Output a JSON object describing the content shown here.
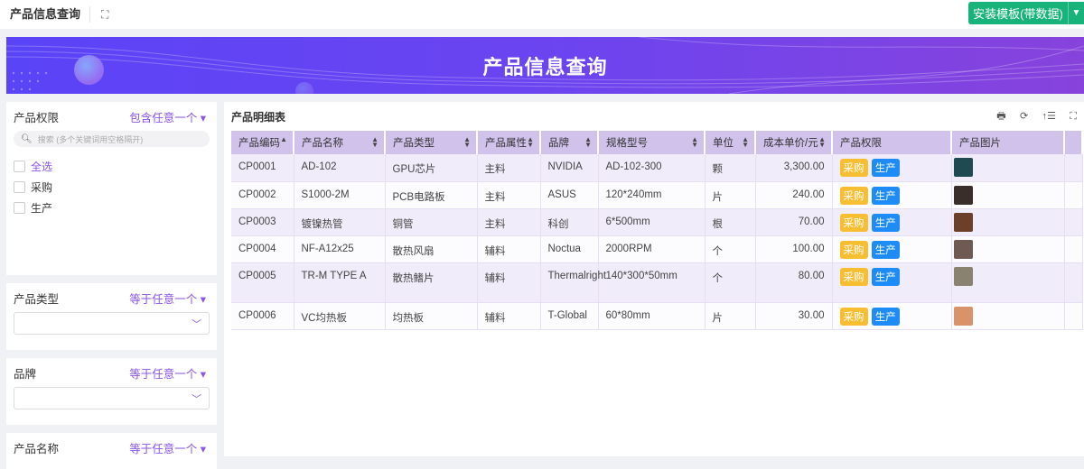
{
  "topbar": {
    "title": "产品信息查询",
    "install_label": "安装模板(带数据)"
  },
  "banner": {
    "title": "产品信息查询"
  },
  "filters": [
    {
      "label": "产品权限",
      "mode": "包含任意一个",
      "search_placeholder": "搜索 (多个关键词用空格隔开)",
      "options": [
        "全选",
        "采购",
        "生产"
      ]
    },
    {
      "label": "产品类型",
      "mode": "等于任意一个"
    },
    {
      "label": "品牌",
      "mode": "等于任意一个"
    },
    {
      "label": "产品名称",
      "mode": "等于任意一个"
    }
  ],
  "table": {
    "title": "产品明细表",
    "columns": [
      "产品编码",
      "产品名称",
      "产品类型",
      "产品属性",
      "品牌",
      "规格型号",
      "单位",
      "成本单价/元",
      "产品权限",
      "产品图片"
    ],
    "rows": [
      {
        "code": "CP0001",
        "name": "AD-102",
        "type": "GPU芯片",
        "attr": "主料",
        "brand": "NVIDIA",
        "spec": "AD-102-300",
        "unit": "颗",
        "price": "3,300.00",
        "perms": [
          "采购",
          "生产"
        ],
        "img": "#1f4a52"
      },
      {
        "code": "CP0002",
        "name": "S1000-2M",
        "type": "PCB电路板",
        "attr": "主料",
        "brand": "ASUS",
        "spec": "120*240mm",
        "unit": "片",
        "price": "240.00",
        "perms": [
          "采购",
          "生产"
        ],
        "img": "#3a2e2a"
      },
      {
        "code": "CP0003",
        "name": "镀镍热管",
        "type": "铜管",
        "attr": "主料",
        "brand": "科创",
        "spec": "6*500mm",
        "unit": "根",
        "price": "70.00",
        "perms": [
          "采购",
          "生产"
        ],
        "img": "#6b3f2a"
      },
      {
        "code": "CP0004",
        "name": "NF-A12x25",
        "type": "散热风扇",
        "attr": "辅料",
        "brand": "Noctua",
        "spec": "2000RPM",
        "unit": "个",
        "price": "100.00",
        "perms": [
          "采购",
          "生产"
        ],
        "img": "#6e5a52"
      },
      {
        "code": "CP0005",
        "name": "TR-M TYPE A",
        "type": "散热鳍片",
        "attr": "辅料",
        "brand": "Thermalright",
        "spec": "140*300*50mm",
        "unit": "个",
        "price": "80.00",
        "perms": [
          "采购",
          "生产"
        ],
        "img": "#8a8270"
      },
      {
        "code": "CP0006",
        "name": "VC均热板",
        "type": "均热板",
        "attr": "辅料",
        "brand": "T-Global",
        "spec": "60*80mm",
        "unit": "片",
        "price": "30.00",
        "perms": [
          "采购",
          "生产"
        ],
        "img": "#d9936a"
      }
    ]
  }
}
